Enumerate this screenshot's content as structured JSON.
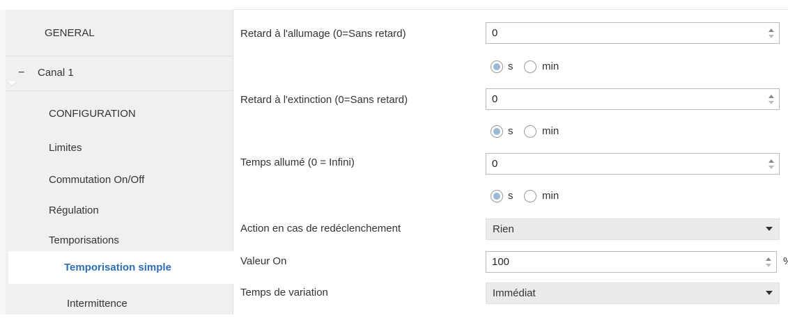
{
  "sidebar": {
    "general": "GENERAL",
    "channel": "Canal 1",
    "collapse_symbol": "−",
    "items": [
      {
        "label": "CONFIGURATION"
      },
      {
        "label": "Limites"
      },
      {
        "label": "Commutation On/Off"
      },
      {
        "label": "Régulation"
      },
      {
        "label": "Temporisations"
      },
      {
        "label": "Temporisation simple",
        "active": true
      },
      {
        "label": "Intermittence"
      }
    ]
  },
  "params": {
    "delay_on": {
      "label": "Retard à l'allumage (0=Sans retard)",
      "value": "0",
      "unit_s": "s",
      "unit_min": "min",
      "selected": "s"
    },
    "delay_off": {
      "label": "Retard à l'extinction (0=Sans retard)",
      "value": "0",
      "unit_s": "s",
      "unit_min": "min",
      "selected": "s"
    },
    "on_time": {
      "label": "Temps allumé (0 = Infini)",
      "value": "0",
      "unit_s": "s",
      "unit_min": "min",
      "selected": "s"
    },
    "retrigger": {
      "label": "Action en cas de redéclenchement",
      "value": "Rien"
    },
    "on_value": {
      "label": "Valeur On",
      "value": "100",
      "unit": "%"
    },
    "dimming_time": {
      "label": "Temps de variation",
      "value": "Immédiat"
    }
  },
  "colors": {
    "accent": "#2e6fb5",
    "radio_fill": "#9bb8d6",
    "sidebar_bg": "#f0f0f0",
    "select_bg": "#ebebeb"
  }
}
